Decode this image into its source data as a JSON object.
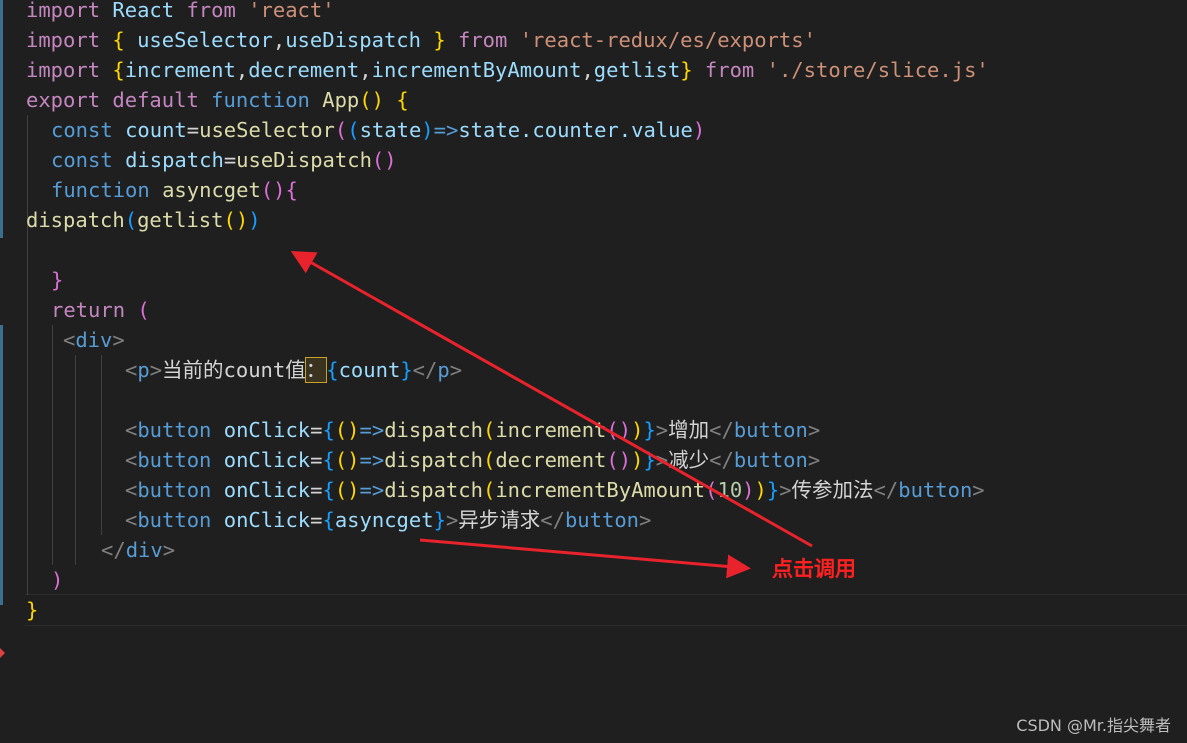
{
  "code": {
    "l1": {
      "kw": "import",
      "name": "React",
      "from": "from",
      "mod": "'react'"
    },
    "l2": {
      "kw": "import",
      "open": "{",
      "a": "useSelector",
      "comma": ",",
      "b": "useDispatch",
      "close": "}",
      "from": "from",
      "mod": "'react-redux/es/exports'"
    },
    "l3": {
      "kw": "import",
      "open": "{",
      "a": "increment",
      "c1": ",",
      "b": "decrement",
      "c2": ",",
      "c": "incrementByAmount",
      "c3": ",",
      "d": "getlist",
      "close": "}",
      "from": "from",
      "mod": "'./store/slice.js'"
    },
    "l4": {
      "export": "export",
      "default": "default",
      "function": "function",
      "name": "App",
      "parens": "()",
      "brace": "{"
    },
    "l5": {
      "const": "const",
      "name": "count",
      "eq": "=",
      "fn": "useSelector",
      "p1": "(",
      "p2": "(",
      "arg": "state",
      "p3": ")",
      "arrow": "=>",
      "expr": "state.counter.value",
      "p4": ")"
    },
    "l6": {
      "const": "const",
      "name": "dispatch",
      "eq": "=",
      "fn": "useDispatch",
      "parens": "()"
    },
    "l7": {
      "function": "function",
      "name": "asyncget",
      "parens": "()",
      "brace": "{"
    },
    "l8": {
      "fn": "dispatch",
      "p1": "(",
      "inner": "getlist",
      "p2": "()",
      "p3": ")"
    },
    "l10": {
      "brace": "}"
    },
    "l11": {
      "return": "return",
      "paren": "("
    },
    "l12": {
      "lt": "<",
      "tag": "div",
      "gt": ">"
    },
    "l13": {
      "lt": "<",
      "tag": "p",
      "gt": ">",
      "text": "当前的count值",
      "colon": "：",
      "open": "{",
      "var": "count",
      "close": "}",
      "lt2": "</",
      "tag2": "p",
      "gt2": ">"
    },
    "l15": {
      "lt": "<",
      "tag": "button",
      "attr": "onClick",
      "eq": "=",
      "open": "{",
      "parens": "()",
      "arrow": "=>",
      "fn": "dispatch",
      "p1": "(",
      "inner": "increment",
      "p2": "()",
      "p3": ")",
      "close": "}",
      "gt": ">",
      "text": "增加",
      "lt2": "</",
      "tag2": "button",
      "gt2": ">"
    },
    "l16": {
      "lt": "<",
      "tag": "button",
      "attr": "onClick",
      "eq": "=",
      "open": "{",
      "parens": "()",
      "arrow": "=>",
      "fn": "dispatch",
      "p1": "(",
      "inner": "decrement",
      "p2": "()",
      "p3": ")",
      "close": "}",
      "gt": ">",
      "text": "减少",
      "lt2": "</",
      "tag2": "button",
      "gt2": ">"
    },
    "l17": {
      "lt": "<",
      "tag": "button",
      "attr": "onClick",
      "eq": "=",
      "open": "{",
      "parens": "()",
      "arrow": "=>",
      "fn": "dispatch",
      "p1": "(",
      "inner": "incrementByAmount",
      "p2": "(",
      "num": "10",
      "p3": ")",
      "p4": ")",
      "close": "}",
      "gt": ">",
      "text": "传参加法",
      "lt2": "</",
      "tag2": "button",
      "gt2": ">"
    },
    "l18": {
      "lt": "<",
      "tag": "button",
      "attr": "onClick",
      "eq": "=",
      "open": "{",
      "var": "asyncget",
      "close": "}",
      "gt": ">",
      "text": "异步请求",
      "lt2": "</",
      "tag2": "button",
      "gt2": ">"
    },
    "l19": {
      "lt": "</",
      "tag": "div",
      "gt": ">"
    },
    "l20": {
      "paren": ")"
    },
    "l21": {
      "brace": "}"
    }
  },
  "annotation": {
    "label": "点击调用",
    "color": "#ff2020"
  },
  "watermark": "CSDN @Mr.指尖舞者",
  "colors": {
    "background": "#1f1f1f",
    "keyword": "#569cd6",
    "control": "#c586c0",
    "string": "#ce9178",
    "variable": "#9cdcfe",
    "function": "#dcdcaa",
    "arrow": "#e8232b"
  }
}
